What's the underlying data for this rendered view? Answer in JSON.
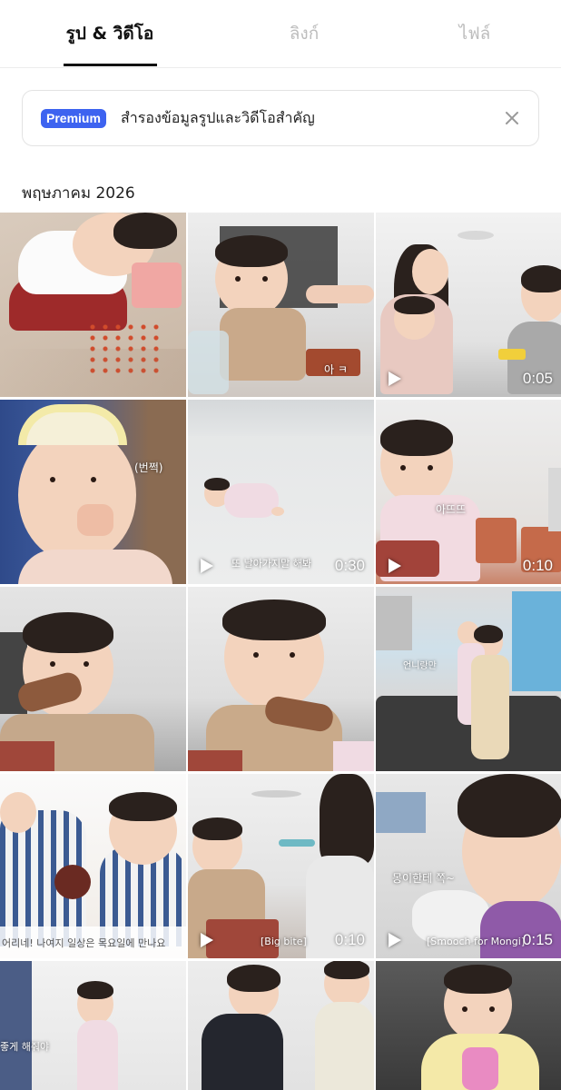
{
  "tabs": [
    {
      "label": "รูป & วิดีโอ",
      "active": true
    },
    {
      "label": "ลิงก์",
      "active": false
    },
    {
      "label": "ไฟล์",
      "active": false
    }
  ],
  "banner": {
    "badge": "Premium",
    "text": "สำรองข้อมูลรูปและวิดีโอสำคัญ",
    "close_icon": "close-icon"
  },
  "section": {
    "title": "พฤษภาคม 2026"
  },
  "tiles": [
    {
      "type": "photo"
    },
    {
      "type": "photo",
      "caption": "아 ㅋ"
    },
    {
      "type": "video",
      "duration": "0:05"
    },
    {
      "type": "photo",
      "caption": "(번쩍)"
    },
    {
      "type": "video",
      "duration": "0:30",
      "caption": "또 날아가지말 해봐"
    },
    {
      "type": "video",
      "duration": "0:10",
      "caption": "아뜨뜨"
    },
    {
      "type": "photo"
    },
    {
      "type": "photo"
    },
    {
      "type": "photo",
      "caption": "언니랑만"
    },
    {
      "type": "photo",
      "caption": "어리네! 나여지 일상은 목요일에 만나요"
    },
    {
      "type": "video",
      "duration": "0:10",
      "caption": "[Big bite]"
    },
    {
      "type": "video",
      "duration": "0:15",
      "caption": "[Smooch for Mongi]",
      "caption2": "몽이한테 쪽~"
    },
    {
      "type": "photo",
      "caption": "좋게 해줘야"
    },
    {
      "type": "photo"
    },
    {
      "type": "photo"
    }
  ],
  "colors": {
    "accent": "#3d63f0",
    "tab_inactive": "#bdbdbd",
    "text": "#222222"
  }
}
